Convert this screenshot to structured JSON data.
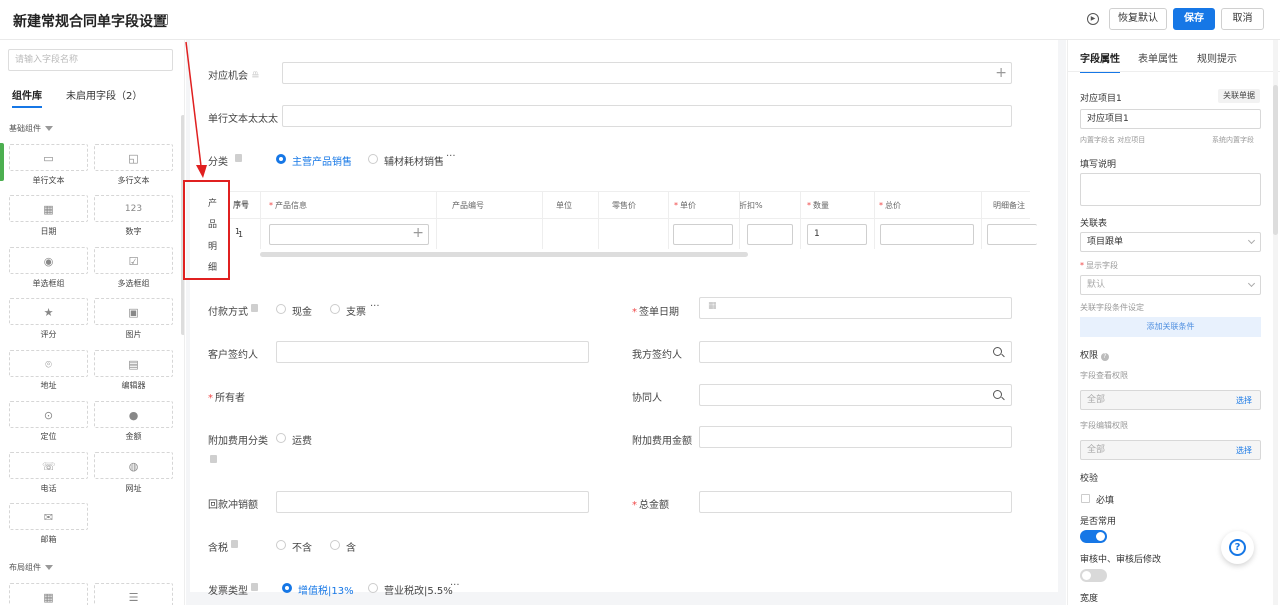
{
  "header": {
    "title": "新建常规合同单字段设置",
    "restore_label": "恢复默认",
    "save_label": "保存",
    "cancel_label": "取消"
  },
  "left_panel": {
    "search_placeholder": "请输入字段名称",
    "tabs": [
      {
        "label": "组件库",
        "active": true
      },
      {
        "label": "未启用字段（2）",
        "active": false
      }
    ],
    "basic_section": "基础组件",
    "layout_section": "布局组件",
    "components": [
      {
        "label": "单行文本",
        "icon": "single-line-text-icon"
      },
      {
        "label": "多行文本",
        "icon": "multi-line-text-icon"
      },
      {
        "label": "日期",
        "icon": "calendar-icon"
      },
      {
        "label": "数字",
        "icon": "number-icon",
        "glyph": "123"
      },
      {
        "label": "单选框组",
        "icon": "radio-group-icon"
      },
      {
        "label": "多选框组",
        "icon": "checkbox-group-icon"
      },
      {
        "label": "评分",
        "icon": "star-icon"
      },
      {
        "label": "图片",
        "icon": "image-icon"
      },
      {
        "label": "地址",
        "icon": "location-pin-icon"
      },
      {
        "label": "编辑器",
        "icon": "editor-icon"
      },
      {
        "label": "定位",
        "icon": "map-pin-icon"
      },
      {
        "label": "金额",
        "icon": "money-icon"
      },
      {
        "label": "电话",
        "icon": "phone-icon"
      },
      {
        "label": "网址",
        "icon": "globe-icon"
      },
      {
        "label": "邮箱",
        "icon": "mail-icon"
      }
    ],
    "layout_components": [
      {
        "icon": "table-icon"
      },
      {
        "icon": "divider-icon"
      }
    ]
  },
  "form": {
    "opportunity_label": "对应机会",
    "single_text_label": "单行文本太太太",
    "category_label": "分类",
    "category_options": [
      "主营产品销售",
      "辅材耗材销售"
    ],
    "product_detail_chars": [
      "产",
      "品",
      "明",
      "细"
    ],
    "table": {
      "headers": [
        "序号",
        "产品信息",
        "产品编号",
        "单位",
        "零售价",
        "单价",
        "折扣%",
        "数量",
        "总价",
        "明细备注"
      ],
      "required": [
        false,
        true,
        false,
        false,
        false,
        true,
        false,
        true,
        true,
        false
      ],
      "row_index": "1",
      "quantity_value": "1"
    },
    "payment_label": "付款方式",
    "payment_options": [
      "现金",
      "支票"
    ],
    "sign_date_label": "签单日期",
    "customer_signer_label": "客户签约人",
    "our_signer_label": "我方签约人",
    "owner_label": "所有者",
    "collaborator_label": "协同人",
    "extra_fee_category_label": "附加费用分类",
    "extra_fee_category_option": "运费",
    "extra_fee_amount_label": "附加费用金额",
    "refund_offset_label": "回款冲销额",
    "total_amount_label": "总金额",
    "tax_label": "含税",
    "tax_options": [
      "不含",
      "含"
    ],
    "invoice_type_label": "发票类型",
    "invoice_options": [
      "增值税|13%",
      "营业税改|5.5%"
    ],
    "more": "···"
  },
  "right_panel": {
    "tabs": [
      {
        "label": "字段属性",
        "active": true
      },
      {
        "label": "表单属性",
        "active": false
      },
      {
        "label": "规则提示",
        "active": false
      }
    ],
    "field_name": "对应项目1",
    "link_form_button": "关联单据",
    "field_value": "对应项目1",
    "internal_field_caption": "内置字段名 对应项目",
    "system_field_caption": "系统内置字段",
    "fill_note_label": "填写说明",
    "linked_table_label": "关联表",
    "linked_table_value": "项目跟单",
    "display_field_label": "显示字段",
    "display_field_value": "默认",
    "link_condition_label": "关联字段条件设定",
    "add_condition_label": "添加关联条件",
    "permission_label": "权限",
    "view_permission_label": "字段查看权限",
    "view_permission_value": "全部",
    "edit_permission_label": "字段编辑权限",
    "edit_permission_value": "全部",
    "choose_label": "选择",
    "validate_label": "校验",
    "required_label": "必填",
    "common_label": "是否常用",
    "common_on": true,
    "review_edit_label": "审核中、审核后修改",
    "review_edit_on": false,
    "width_label": "宽度",
    "accent_color": "#1677e6"
  },
  "help_glyph": "?"
}
